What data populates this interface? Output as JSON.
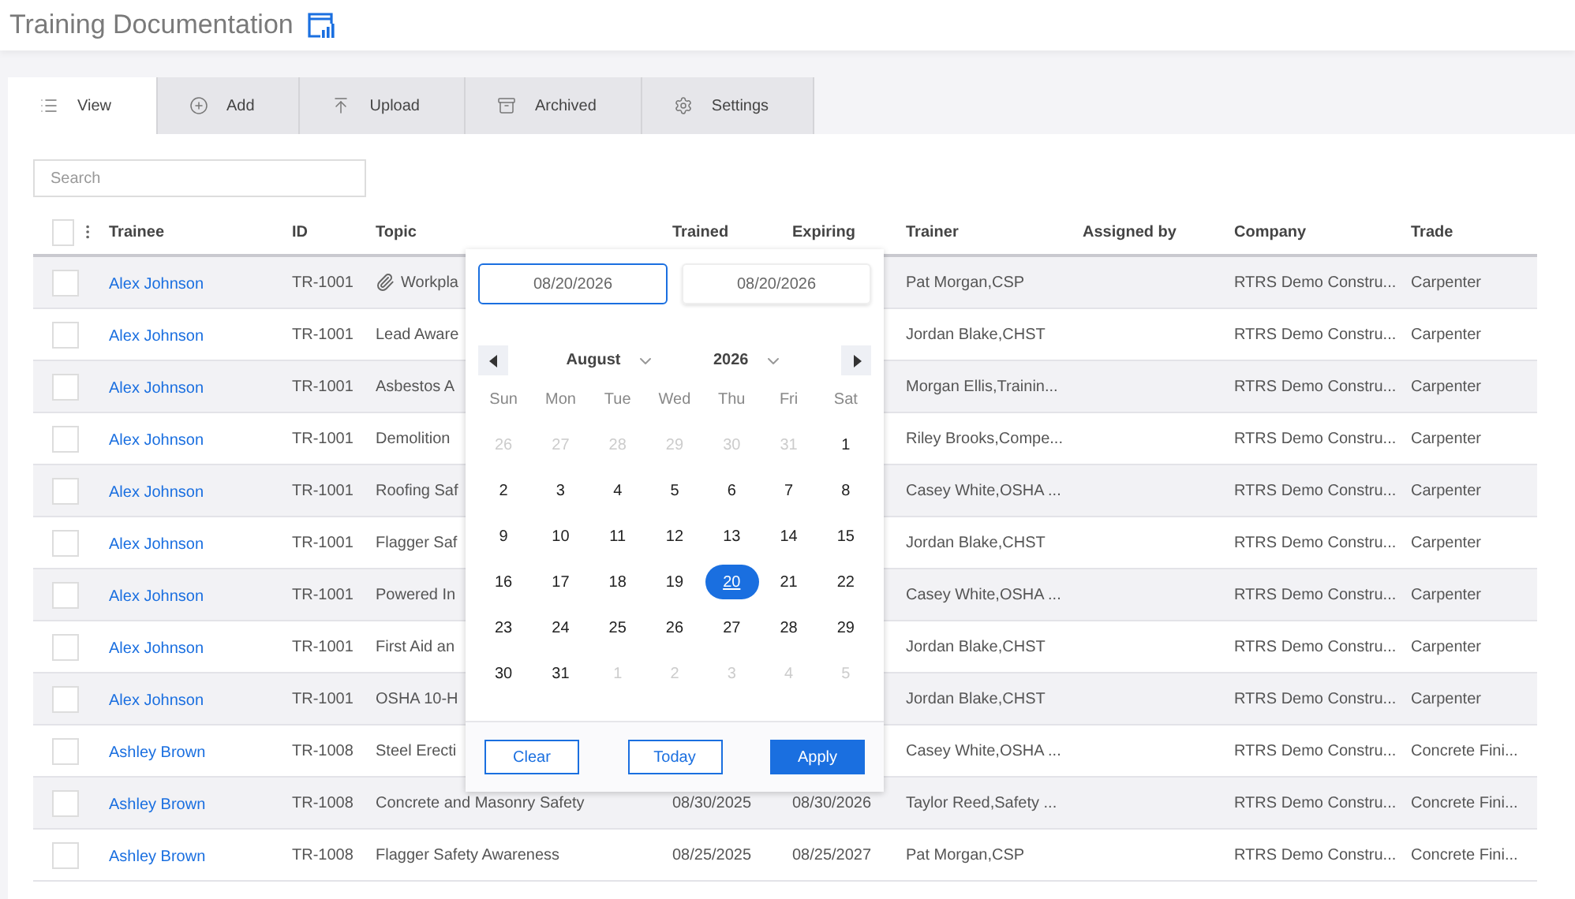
{
  "title": "Training Documentation",
  "tabs": [
    {
      "label": "View",
      "selected": true
    },
    {
      "label": "Add",
      "selected": false
    },
    {
      "label": "Upload",
      "selected": false
    },
    {
      "label": "Archived",
      "selected": false
    },
    {
      "label": "Settings",
      "selected": false
    }
  ],
  "search": {
    "placeholder": "Search"
  },
  "table": {
    "select_all_checked": false,
    "columns": [
      "Trainee",
      "ID",
      "Topic",
      "Trained",
      "Expiring",
      "Trainer",
      "Assigned by",
      "Company",
      "Trade"
    ],
    "rows": [
      {
        "checked": false,
        "trainee": "Alex Johnson",
        "id": "TR-1001",
        "topic": "Workpla",
        "attachment": true,
        "trainer": "Pat Morgan,CSP",
        "company": "RTRS Demo Constru...",
        "trade": "Carpenter"
      },
      {
        "checked": false,
        "trainee": "Alex Johnson",
        "id": "TR-1001",
        "topic": "Lead Aware",
        "attachment": false,
        "trainer": "Jordan Blake,CHST",
        "company": "RTRS Demo Constru...",
        "trade": "Carpenter"
      },
      {
        "checked": false,
        "trainee": "Alex Johnson",
        "id": "TR-1001",
        "topic": "Asbestos A",
        "attachment": false,
        "trainer": "Morgan Ellis,Trainin...",
        "company": "RTRS Demo Constru...",
        "trade": "Carpenter"
      },
      {
        "checked": false,
        "trainee": "Alex Johnson",
        "id": "TR-1001",
        "topic": "Demolition",
        "attachment": false,
        "trainer": "Riley Brooks,Compe...",
        "company": "RTRS Demo Constru...",
        "trade": "Carpenter"
      },
      {
        "checked": false,
        "trainee": "Alex Johnson",
        "id": "TR-1001",
        "topic": "Roofing Saf",
        "attachment": false,
        "trainer": "Casey White,OSHA ...",
        "company": "RTRS Demo Constru...",
        "trade": "Carpenter"
      },
      {
        "checked": false,
        "trainee": "Alex Johnson",
        "id": "TR-1001",
        "topic": "Flagger Saf",
        "attachment": false,
        "trainer": "Jordan Blake,CHST",
        "company": "RTRS Demo Constru...",
        "trade": "Carpenter"
      },
      {
        "checked": false,
        "trainee": "Alex Johnson",
        "id": "TR-1001",
        "topic": "Powered In",
        "attachment": false,
        "trainer": "Casey White,OSHA ...",
        "company": "RTRS Demo Constru...",
        "trade": "Carpenter"
      },
      {
        "checked": false,
        "trainee": "Alex Johnson",
        "id": "TR-1001",
        "topic": "First Aid an",
        "attachment": false,
        "trainer": "Jordan Blake,CHST",
        "company": "RTRS Demo Constru...",
        "trade": "Carpenter"
      },
      {
        "checked": false,
        "trainee": "Alex Johnson",
        "id": "TR-1001",
        "topic": "OSHA 10-H",
        "attachment": false,
        "trainer": "Jordan Blake,CHST",
        "company": "RTRS Demo Constru...",
        "trade": "Carpenter"
      },
      {
        "checked": false,
        "trainee": "Ashley Brown",
        "id": "TR-1008",
        "topic": "Steel Erecti",
        "attachment": false,
        "trainer": "Casey White,OSHA ...",
        "company": "RTRS Demo Constru...",
        "trade": "Concrete Fini..."
      },
      {
        "checked": false,
        "trainee": "Ashley Brown",
        "id": "TR-1008",
        "topic": "Concrete and Masonry Safety",
        "attachment": false,
        "trained": "08/30/2025",
        "expiring": "08/30/2026",
        "trainer": "Taylor Reed,Safety ...",
        "company": "RTRS Demo Constru...",
        "trade": "Concrete Fini..."
      },
      {
        "checked": false,
        "trainee": "Ashley Brown",
        "id": "TR-1008",
        "topic": "Flagger Safety Awareness",
        "attachment": false,
        "trained": "08/25/2025",
        "expiring": "08/25/2027",
        "trainer": "Pat Morgan,CSP",
        "company": "RTRS Demo Constru...",
        "trade": "Concrete Fini..."
      }
    ]
  },
  "datepicker": {
    "start": "08/20/2026",
    "end": "08/20/2026",
    "month": "August",
    "year": "2026",
    "weekdays": [
      "Sun",
      "Mon",
      "Tue",
      "Wed",
      "Thu",
      "Fri",
      "Sat"
    ],
    "days": [
      {
        "label": "26",
        "muted": true,
        "selected": false
      },
      {
        "label": "27",
        "muted": true,
        "selected": false
      },
      {
        "label": "28",
        "muted": true,
        "selected": false
      },
      {
        "label": "29",
        "muted": true,
        "selected": false
      },
      {
        "label": "30",
        "muted": true,
        "selected": false
      },
      {
        "label": "31",
        "muted": true,
        "selected": false
      },
      {
        "label": "1",
        "muted": false,
        "selected": false
      },
      {
        "label": "2",
        "muted": false,
        "selected": false
      },
      {
        "label": "3",
        "muted": false,
        "selected": false
      },
      {
        "label": "4",
        "muted": false,
        "selected": false
      },
      {
        "label": "5",
        "muted": false,
        "selected": false
      },
      {
        "label": "6",
        "muted": false,
        "selected": false
      },
      {
        "label": "7",
        "muted": false,
        "selected": false
      },
      {
        "label": "8",
        "muted": false,
        "selected": false
      },
      {
        "label": "9",
        "muted": false,
        "selected": false
      },
      {
        "label": "10",
        "muted": false,
        "selected": false
      },
      {
        "label": "11",
        "muted": false,
        "selected": false
      },
      {
        "label": "12",
        "muted": false,
        "selected": false
      },
      {
        "label": "13",
        "muted": false,
        "selected": false
      },
      {
        "label": "14",
        "muted": false,
        "selected": false
      },
      {
        "label": "15",
        "muted": false,
        "selected": false
      },
      {
        "label": "16",
        "muted": false,
        "selected": false
      },
      {
        "label": "17",
        "muted": false,
        "selected": false
      },
      {
        "label": "18",
        "muted": false,
        "selected": false
      },
      {
        "label": "19",
        "muted": false,
        "selected": false
      },
      {
        "label": "20",
        "muted": false,
        "selected": true
      },
      {
        "label": "21",
        "muted": false,
        "selected": false
      },
      {
        "label": "22",
        "muted": false,
        "selected": false
      },
      {
        "label": "23",
        "muted": false,
        "selected": false
      },
      {
        "label": "24",
        "muted": false,
        "selected": false
      },
      {
        "label": "25",
        "muted": false,
        "selected": false
      },
      {
        "label": "26",
        "muted": false,
        "selected": false
      },
      {
        "label": "27",
        "muted": false,
        "selected": false
      },
      {
        "label": "28",
        "muted": false,
        "selected": false
      },
      {
        "label": "29",
        "muted": false,
        "selected": false
      },
      {
        "label": "30",
        "muted": false,
        "selected": false
      },
      {
        "label": "31",
        "muted": false,
        "selected": false
      },
      {
        "label": "1",
        "muted": true,
        "selected": false
      },
      {
        "label": "2",
        "muted": true,
        "selected": false
      },
      {
        "label": "3",
        "muted": true,
        "selected": false
      },
      {
        "label": "4",
        "muted": true,
        "selected": false
      },
      {
        "label": "5",
        "muted": true,
        "selected": false
      }
    ],
    "buttons": [
      {
        "label": "Clear",
        "kind": "outline"
      },
      {
        "label": "Today",
        "kind": "outline"
      },
      {
        "label": "Apply",
        "kind": "primary"
      }
    ]
  }
}
